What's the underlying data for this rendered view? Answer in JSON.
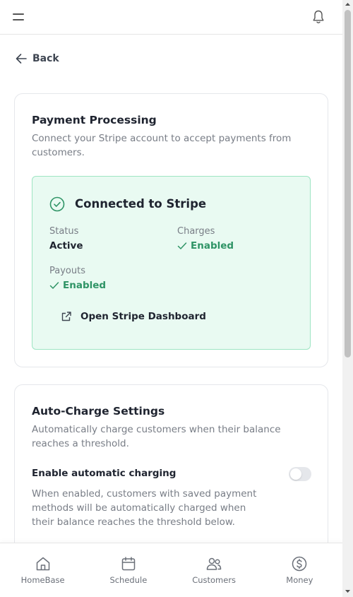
{
  "header": {
    "menu_icon": "hamburger-menu-icon",
    "notification_icon": "bell-icon"
  },
  "back": {
    "label": "Back",
    "icon": "arrow-left-icon"
  },
  "payment_processing": {
    "title": "Payment Processing",
    "description": "Connect your Stripe account to accept payments from customers.",
    "connection": {
      "icon": "check-circle-icon",
      "title": "Connected to Stripe",
      "status_label": "Status",
      "status_value": "Active",
      "charges_label": "Charges",
      "charges_value": "Enabled",
      "payouts_label": "Payouts",
      "payouts_value": "Enabled",
      "dashboard_link": "Open Stripe Dashboard",
      "dashboard_icon": "external-link-icon"
    }
  },
  "auto_charge": {
    "title": "Auto-Charge Settings",
    "description": "Automatically charge customers when their balance reaches a threshold.",
    "toggle_label": "Enable automatic charging",
    "toggle_enabled": false,
    "toggle_description": "When enabled, customers with saved payment methods will be automatically charged when their balance reaches the threshold below."
  },
  "bottom_nav": {
    "items": [
      {
        "label": "HomeBase",
        "icon": "home-icon"
      },
      {
        "label": "Schedule",
        "icon": "calendar-icon"
      },
      {
        "label": "Customers",
        "icon": "users-icon"
      },
      {
        "label": "Money",
        "icon": "dollar-circle-icon"
      }
    ]
  },
  "colors": {
    "accent_green": "#2f9466",
    "success_bg": "#e9faf2",
    "success_border": "#9ee5c3",
    "text_primary": "#1f2430",
    "text_muted": "#787d86"
  }
}
